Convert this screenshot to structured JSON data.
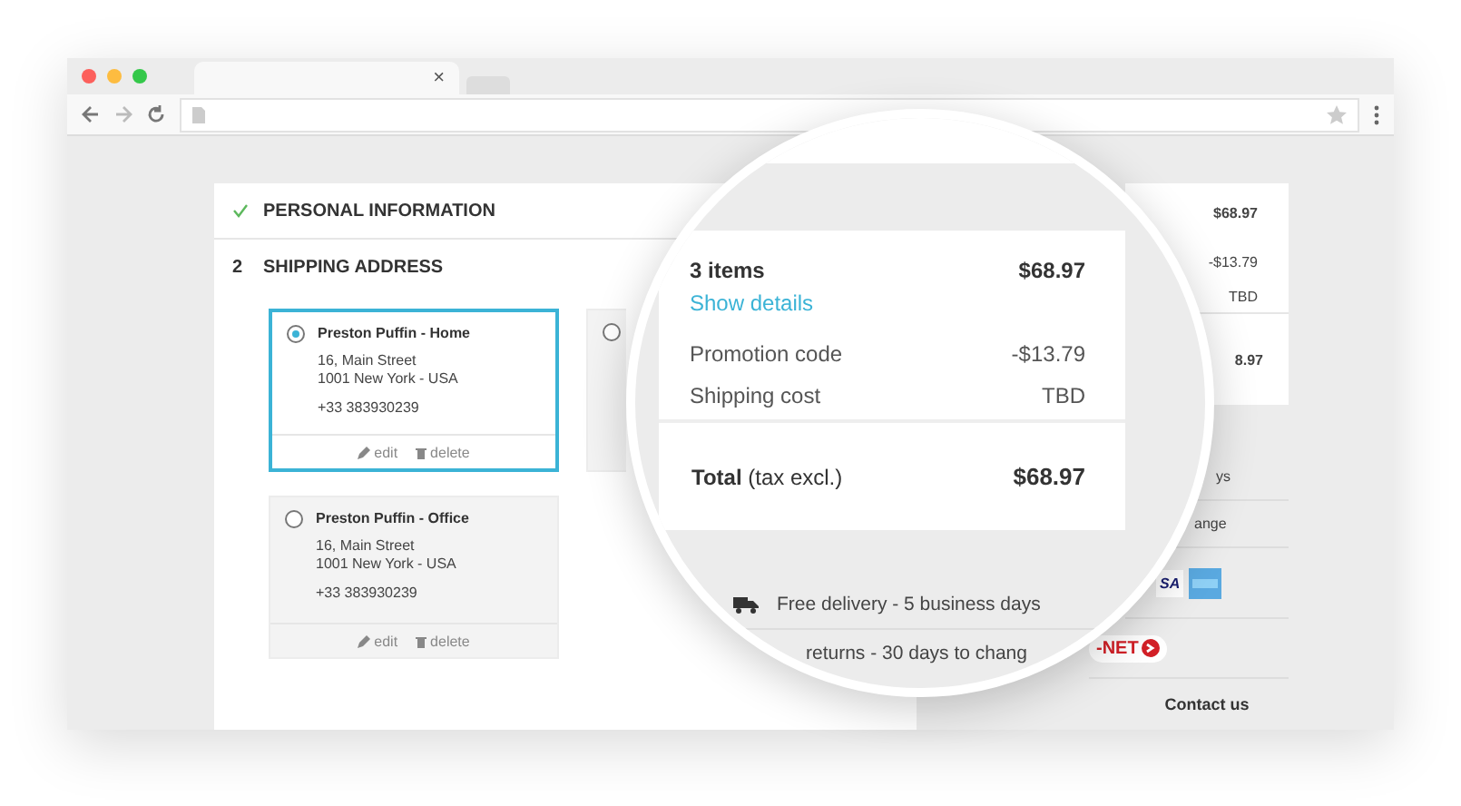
{
  "browser": {
    "tab_close": "×"
  },
  "steps": [
    {
      "kind": "done",
      "title": "PERSONAL INFORMATION"
    },
    {
      "kind": "current",
      "number": "2",
      "title": "SHIPPING ADDRESS"
    }
  ],
  "addresses": [
    {
      "kind": "full",
      "selected": true,
      "name": "Preston Puffin - Home",
      "street": "16, Main Street",
      "city": "1001 New York - USA",
      "phone": "+33 383930239",
      "edit": "edit",
      "delete": "delete"
    },
    {
      "kind": "covered",
      "selected": false
    },
    {
      "kind": "full",
      "selected": false,
      "name": "Preston Puffin - Office",
      "street": "16, Main Street",
      "city": "1001 New York - USA",
      "phone": "+33 383930239",
      "edit": "edit",
      "delete": "delete"
    }
  ],
  "summary_panel": {
    "subtotal": "$68.97",
    "promotion": "-$13.79",
    "shipping": "TBD",
    "total": "8.97"
  },
  "side_notes": [
    "ys",
    "ange"
  ],
  "visa_text": "SA",
  "badge_text": "-NET",
  "contact": "Contact us",
  "magnifier": {
    "items": "3 items",
    "items_total": "$68.97",
    "details_link": "Show details",
    "lines": [
      {
        "label": "Promotion code",
        "value": "-$13.79"
      },
      {
        "label": "Shipping cost",
        "value": "TBD"
      }
    ],
    "total_label": "**Total** (tax excl.)",
    "total": "$68.97",
    "reassurance": [
      {
        "kind": "delivery",
        "text": "Free delivery - 5 business days"
      },
      {
        "kind": "returns",
        "text": "returns - 30 days to chang"
      }
    ]
  }
}
